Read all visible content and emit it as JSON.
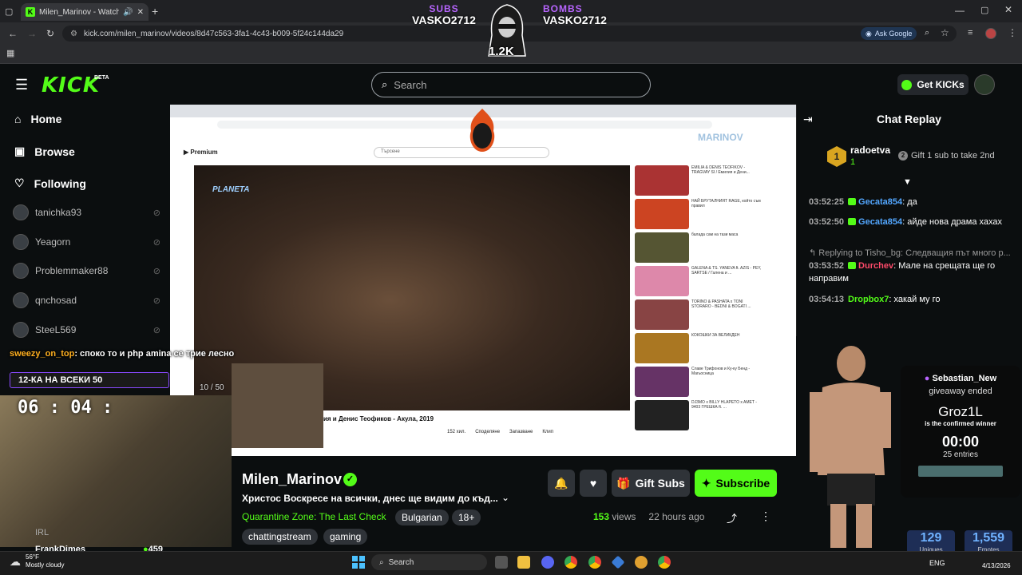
{
  "browser": {
    "tab_title": "Milen_Marinov - Watch the",
    "url": "kick.com/milen_marinov/videos/8d47c563-3fa1-4c43-b009-5f24c144da29",
    "ask_google": "Ask Google"
  },
  "stream_overlay": {
    "subs_label": "SUBS",
    "subs_user": "VASKO2712",
    "bombs_label": "BOMBS",
    "bombs_user": "VASKO2712",
    "count": "1.2K",
    "watermark": "MARINOV"
  },
  "header": {
    "logo": "KICK",
    "beta": "BETA",
    "search_placeholder": "Search",
    "get_kicks": "Get KICKs"
  },
  "sidebar": {
    "nav": [
      {
        "label": "Home",
        "icon": "home-icon"
      },
      {
        "label": "Browse",
        "icon": "browse-icon"
      },
      {
        "label": "Following",
        "icon": "heart-icon"
      }
    ],
    "channels": [
      "tanichka93",
      "Yeagorn",
      "Problemmaker88",
      "qnchosad",
      "SteeL569"
    ],
    "bottom_label": "IRL",
    "bottom_channel": "FrankDimes",
    "bottom_viewers": "459"
  },
  "video_overlay": {
    "chat_user": "sweezy_on_top",
    "chat_text": ": споко то и php amina се трие лесно",
    "goal_label": "12-КА НА ВСЕКИ 50",
    "goal_progress": "10 / 50",
    "timer": "06 : 04 :",
    "yt_caption": "ия и Денис Теофиков - Акула, 2019",
    "yt_search": "Търсене",
    "yt_views": "152 хил.",
    "yt_share": "Споделяне",
    "yt_save": "Запазване",
    "yt_clip": "Клип",
    "yt_sidebar": [
      "EMILIA & DENIS TEOFIKOV - TRAGVAY SI / Емилия и Дени...",
      "НАЙ БРУТАЛНИЯТ RAGE, който съм правил",
      "балада сам на тази маса",
      "GALENA & TS. YANEVA ft. AZIS - PEY, SARTSE / Галена и ...",
      "TORINO & PASHATA x TONI STORARO - BEDNI & BOGATI ...",
      "КОКОШКИ ЗА ВЕЛИКДЕН",
      "Славе Трифонов и Ку-ку Бенд - Магьосница",
      "DJ3MO x BILLY HLAPETO x AMET - 9403 ГРЕШКА ft. ..."
    ]
  },
  "stream_info": {
    "streamer": "Milen_Marinov",
    "title": "Христос Воскресе на всички, днес ще видим до къд...",
    "category": "Quarantine Zone: The Last Check",
    "language": "Bulgarian",
    "rating": "18+",
    "tags": [
      "chattingstream",
      "gaming"
    ],
    "views_count": "153",
    "views_label": "views",
    "age": "22 hours ago",
    "gift_subs": "Gift Subs",
    "subscribe": "Subscribe"
  },
  "chat": {
    "title": "Chat Replay",
    "top_user": "radoetva",
    "top_count": "1",
    "gift_prompt": "Gift 1 sub to take 2nd",
    "messages": [
      {
        "time": "03:52:25",
        "user": "Gecata854",
        "text": ": да"
      },
      {
        "time": "03:52:50",
        "user": "Gecata854",
        "text": ": айде нова драма хахах"
      },
      {
        "reply": "Replying to Tisho_bg: Следващия път много р...",
        "time": "03:53:52",
        "user": "Durchev",
        "text": ": Мале на срещата ще го направим"
      },
      {
        "time": "03:54:13",
        "user": "Dropbox7",
        "text": ": хакай му го"
      }
    ]
  },
  "giveaway": {
    "host": "Sebastian_New",
    "status": "giveaway ended",
    "winner": "Groz1L",
    "winner_note": "is the confirmed winner",
    "timer": "00:00",
    "entries": "25 entries"
  },
  "stats": {
    "uniques": "129",
    "uniques_label": "Uniques",
    "emotes": "1,559",
    "emotes_label": "Emotes"
  },
  "taskbar": {
    "weather_temp": "56°F",
    "weather_desc": "Mostly cloudy",
    "search": "Search",
    "lang": "ENG",
    "date": "4/13/2026"
  }
}
